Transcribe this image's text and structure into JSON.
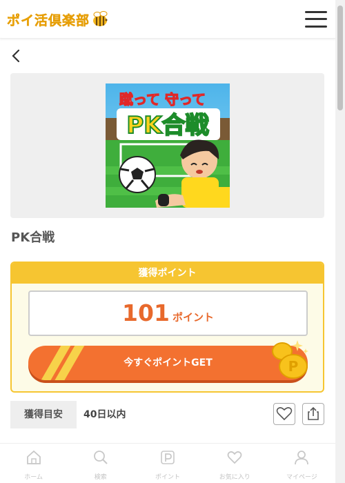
{
  "header": {
    "logo_text": "ポイ活倶楽部",
    "logo_icon": "bee-icon",
    "menu_icon": "hamburger-menu-icon"
  },
  "nav": {
    "back_icon": "chevron-left-icon"
  },
  "game": {
    "image_title_top": "蹴って 守って",
    "image_title_main": "PK合戦",
    "title": "PK合戦"
  },
  "points": {
    "header": "獲得ポイント",
    "value": "101",
    "unit": "ポイント",
    "button_label": "今すぐポイントGET",
    "coin_icon": "coin-icon"
  },
  "estimate": {
    "label": "獲得目安",
    "value": "40日以内"
  },
  "actions": {
    "favorite_icon": "heart-icon",
    "share_icon": "share-icon"
  },
  "bottom_nav": [
    {
      "label": "ホーム",
      "icon": "home-icon"
    },
    {
      "label": "検索",
      "icon": "search-icon"
    },
    {
      "label": "ポイント",
      "icon": "point-icon"
    },
    {
      "label": "お気に入り",
      "icon": "heart-icon"
    },
    {
      "label": "マイページ",
      "icon": "user-icon"
    }
  ],
  "colors": {
    "brand_yellow": "#f6c531",
    "accent_orange": "#f37130",
    "point_text": "#e8692c"
  }
}
